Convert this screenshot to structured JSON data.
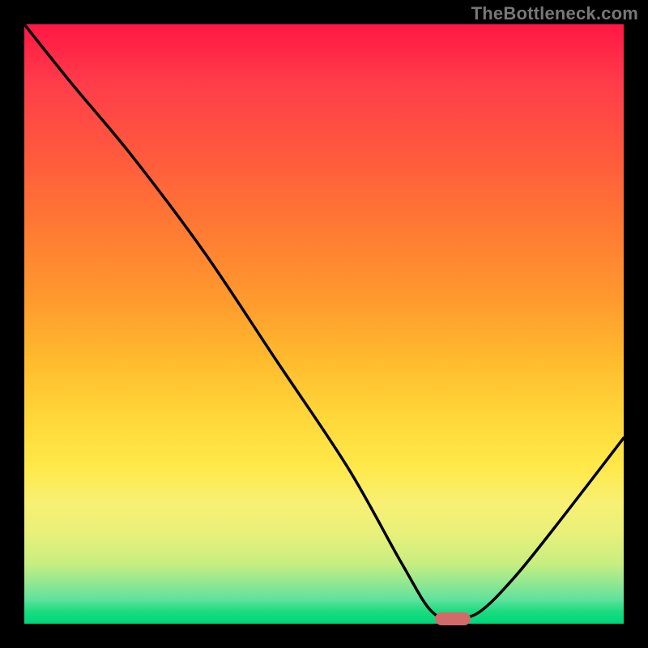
{
  "watermark": "TheBottleneck.com",
  "colors": {
    "frame_bg": "#000000",
    "watermark": "#777777",
    "curve": "#000000",
    "marker": "#d36a6a",
    "gradient_top": "#ff1744",
    "gradient_bottom": "#00d67a"
  },
  "marker": {
    "x_frac": 0.715,
    "y_frac": 0.992
  },
  "chart_data": {
    "type": "line",
    "title": "",
    "xlabel": "",
    "ylabel": "",
    "xlim": [
      0,
      1
    ],
    "ylim": [
      0,
      1
    ],
    "grid": false,
    "series": [
      {
        "name": "bottleneck-curve",
        "x": [
          0.0,
          0.08,
          0.18,
          0.3,
          0.42,
          0.54,
          0.63,
          0.68,
          0.72,
          0.76,
          0.82,
          0.9,
          1.0
        ],
        "y": [
          1.0,
          0.9,
          0.78,
          0.62,
          0.44,
          0.26,
          0.1,
          0.02,
          0.01,
          0.02,
          0.08,
          0.18,
          0.31
        ]
      }
    ],
    "annotations": [
      {
        "name": "optimal-marker",
        "x": 0.715,
        "y": 0.008
      }
    ]
  }
}
